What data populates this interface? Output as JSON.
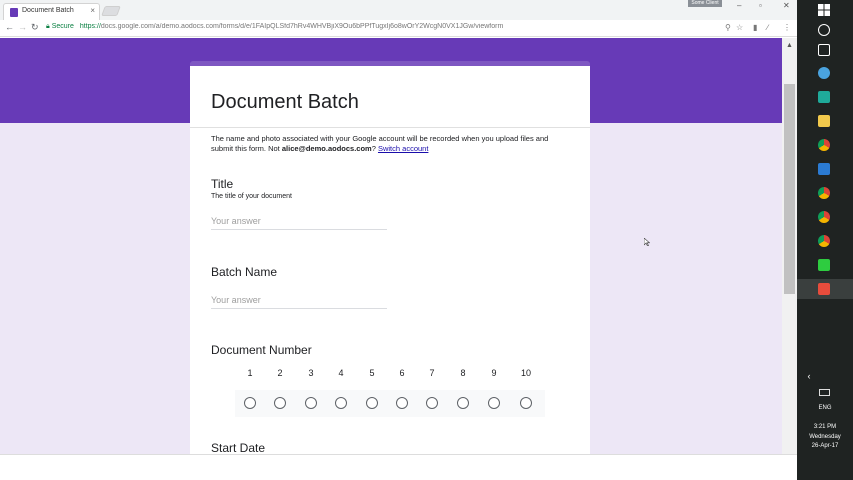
{
  "browser": {
    "tab_title": "Document Batch",
    "tab_close": "×",
    "badge": "Some Client",
    "url_secure": "Secure",
    "url_scheme": "https://",
    "url_rest": "docs.google.com/a/demo.aodocs.com/forms/d/e/1FAIpQLSfd7hRv4WHVBjiX9Ou6bPPfTugxIj6o8wOrY2WcgN0VX1JGw/viewform",
    "back_icon": "←",
    "forward_icon": "→",
    "reload_icon": "↻"
  },
  "form": {
    "title": "Document Batch",
    "description_prefix": "The name and photo associated with your Google account will be recorded when you upload files and submit this form. Not ",
    "account_email": "alice@demo.aodocs.com",
    "description_q": "?",
    "switch_account": "Switch account",
    "questions": {
      "title": {
        "label": "Title",
        "help": "The title of your document",
        "placeholder": "Your answer"
      },
      "batch": {
        "label": "Batch Name",
        "placeholder": "Your answer"
      },
      "docnum": {
        "label": "Document Number",
        "scale": [
          "1",
          "2",
          "3",
          "4",
          "5",
          "6",
          "7",
          "8",
          "9",
          "10"
        ]
      },
      "startdate": {
        "label": "Start Date"
      }
    }
  },
  "taskbar": {
    "lang": "ENG",
    "time": "3:21 PM",
    "day": "Wednesday",
    "date": "26-Apr-17",
    "collapse_icon": "‹"
  },
  "colors": {
    "accent": "#673ab7",
    "page_bg": "#ede7f6",
    "taskbar_bg": "#1f2322"
  }
}
